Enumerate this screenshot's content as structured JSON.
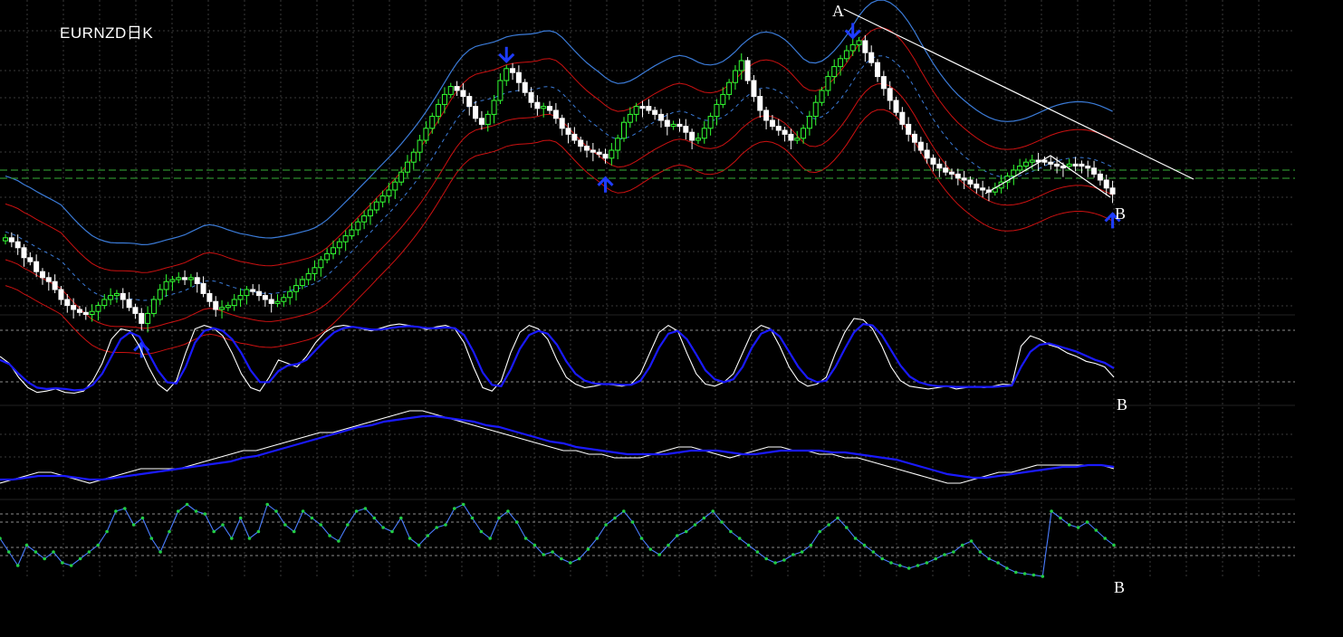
{
  "chart_data": [
    {
      "type": "candlestick",
      "title": "EURNZD日K",
      "grid": true,
      "overlays": [
        "Bollinger upper (blue)",
        "Keltner bands (red)",
        "middle dashed (blue)"
      ],
      "annotations": [
        {
          "label": "A",
          "bar": 137
        },
        {
          "label": "B",
          "bar": 179
        }
      ],
      "horizontal_levels_color": "#2e8b2e",
      "up_color": "#33ff33",
      "down_color": "#ffffff",
      "arrow_color": "#1e3cff",
      "arrows": [
        {
          "bar": 22,
          "dir": "up"
        },
        {
          "bar": 81,
          "dir": "down"
        },
        {
          "bar": 97,
          "dir": "up"
        },
        {
          "bar": 137,
          "dir": "down"
        },
        {
          "bar": 179,
          "dir": "up"
        }
      ],
      "close": [
        228,
        232,
        238,
        248,
        252,
        262,
        268,
        272,
        280,
        290,
        296,
        300,
        303,
        305,
        302,
        296,
        290,
        286,
        284,
        290,
        298,
        304,
        314,
        304,
        290,
        280,
        272,
        270,
        268,
        270,
        268,
        274,
        284,
        292,
        300,
        298,
        296,
        290,
        286,
        280,
        282,
        286,
        290,
        294,
        292,
        288,
        282,
        276,
        270,
        264,
        258,
        250,
        244,
        238,
        232,
        226,
        220,
        212,
        206,
        200,
        192,
        186,
        180,
        172,
        162,
        152,
        142,
        130,
        118,
        106,
        94,
        84,
        76,
        80,
        86,
        96,
        108,
        114,
        104,
        90,
        70,
        58,
        62,
        72,
        82,
        92,
        98,
        96,
        100,
        108,
        118,
        124,
        130,
        136,
        140,
        142,
        144,
        148,
        140,
        128,
        112,
        104,
        96,
        96,
        100,
        104,
        110,
        116,
        114,
        116,
        122,
        130,
        128,
        118,
        106,
        94,
        84,
        72,
        60,
        50,
        70,
        86,
        100,
        110,
        116,
        120,
        124,
        130,
        128,
        118,
        106,
        92,
        80,
        66,
        56,
        48,
        40,
        34,
        30,
        42,
        52,
        66,
        78,
        90,
        102,
        114,
        124,
        132,
        140,
        148,
        154,
        158,
        162,
        164,
        168,
        170,
        174,
        178,
        180,
        182,
        178,
        172,
        166,
        160,
        156,
        152,
        150,
        150,
        152,
        154,
        156,
        156,
        154,
        154,
        156,
        158,
        164,
        170,
        178,
        184
      ]
    },
    {
      "type": "line",
      "name": "oscillator-1",
      "series": [
        {
          "color": "#ffffff",
          "values": [
            55,
            45,
            25,
            10,
            3,
            5,
            8,
            3,
            2,
            5,
            20,
            45,
            80,
            95,
            92,
            70,
            40,
            15,
            5,
            20,
            60,
            95,
            100,
            96,
            85,
            60,
            30,
            10,
            5,
            25,
            50,
            45,
            40,
            55,
            75,
            90,
            98,
            100,
            98,
            95,
            92,
            96,
            100,
            102,
            100,
            98,
            94,
            98,
            100,
            95,
            75,
            40,
            10,
            5,
            20,
            60,
            90,
            100,
            95,
            80,
            50,
            25,
            15,
            10,
            12,
            15,
            14,
            12,
            15,
            30,
            60,
            90,
            100,
            92,
            60,
            30,
            15,
            12,
            18,
            30,
            60,
            90,
            100,
            95,
            70,
            40,
            20,
            12,
            15,
            25,
            60,
            90,
            110,
            108,
            95,
            70,
            40,
            20,
            12,
            10,
            8,
            10,
            12,
            8,
            10,
            12,
            10,
            12,
            15,
            14,
            70,
            85,
            80,
            72,
            68,
            60,
            55,
            48,
            45,
            40,
            25
          ]
        },
        {
          "color": "#1a1aff",
          "values": [
            50,
            44,
            30,
            18,
            10,
            8,
            9,
            8,
            6,
            7,
            14,
            30,
            55,
            80,
            90,
            84,
            60,
            35,
            18,
            16,
            40,
            75,
            92,
            96,
            92,
            80,
            60,
            35,
            18,
            18,
            34,
            42,
            44,
            50,
            64,
            78,
            90,
            96,
            98,
            96,
            94,
            94,
            96,
            98,
            99,
            98,
            96,
            96,
            97,
            96,
            86,
            62,
            32,
            14,
            12,
            36,
            66,
            86,
            92,
            88,
            72,
            48,
            30,
            20,
            16,
            15,
            15,
            14,
            14,
            20,
            40,
            68,
            88,
            92,
            80,
            58,
            35,
            22,
            18,
            22,
            40,
            68,
            88,
            94,
            84,
            62,
            40,
            24,
            18,
            20,
            40,
            66,
            90,
            102,
            100,
            86,
            64,
            42,
            26,
            18,
            14,
            12,
            12,
            11,
            11,
            11,
            11,
            11,
            12,
            13,
            40,
            62,
            72,
            74,
            70,
            66,
            62,
            56,
            50,
            46,
            38
          ]
        }
      ]
    },
    {
      "type": "line",
      "name": "oscillator-2",
      "series": [
        {
          "color": "#ffffff",
          "values": [
            52,
            54,
            56,
            58,
            58,
            56,
            54,
            52,
            54,
            56,
            58,
            60,
            60,
            60,
            60,
            62,
            64,
            66,
            68,
            70,
            70,
            72,
            74,
            76,
            78,
            80,
            80,
            82,
            84,
            86,
            88,
            90,
            92,
            92,
            90,
            88,
            86,
            84,
            82,
            80,
            78,
            76,
            74,
            72,
            70,
            70,
            68,
            68,
            66,
            66,
            66,
            68,
            70,
            72,
            72,
            70,
            68,
            66,
            68,
            70,
            72,
            72,
            70,
            70,
            68,
            68,
            66,
            66,
            64,
            62,
            60,
            58,
            56,
            54,
            52,
            52,
            54,
            56,
            58,
            58,
            60,
            62,
            62,
            62,
            62,
            62,
            62,
            60
          ]
        },
        {
          "color": "#1a1aff",
          "values": [
            54,
            54,
            55,
            56,
            56,
            56,
            55,
            54,
            54,
            55,
            56,
            57,
            58,
            59,
            60,
            61,
            62,
            63,
            64,
            66,
            67,
            69,
            71,
            73,
            75,
            77,
            79,
            81,
            83,
            84,
            86,
            87,
            88,
            89,
            89,
            88,
            87,
            86,
            84,
            83,
            81,
            79,
            77,
            75,
            74,
            72,
            71,
            70,
            69,
            68,
            68,
            68,
            68,
            69,
            70,
            70,
            70,
            69,
            68,
            68,
            69,
            70,
            70,
            70,
            70,
            69,
            69,
            68,
            67,
            66,
            65,
            63,
            61,
            59,
            57,
            56,
            55,
            55,
            56,
            57,
            58,
            59,
            60,
            61,
            61,
            62,
            62,
            61
          ]
        }
      ]
    },
    {
      "type": "line",
      "name": "oscillator-3",
      "series": [
        {
          "color": "#4a7dff",
          "marker_color": "#22cc44",
          "values": [
            40,
            30,
            20,
            35,
            30,
            25,
            30,
            22,
            20,
            25,
            30,
            35,
            45,
            60,
            62,
            50,
            55,
            40,
            30,
            45,
            60,
            65,
            60,
            58,
            45,
            50,
            40,
            55,
            40,
            45,
            65,
            60,
            50,
            45,
            60,
            55,
            50,
            42,
            38,
            50,
            60,
            62,
            55,
            48,
            45,
            55,
            40,
            35,
            42,
            48,
            50,
            62,
            65,
            55,
            45,
            40,
            55,
            60,
            52,
            40,
            35,
            28,
            30,
            25,
            22,
            25,
            32,
            40,
            50,
            55,
            60,
            52,
            40,
            32,
            28,
            35,
            42,
            45,
            50,
            55,
            60,
            52,
            45,
            40,
            35,
            30,
            25,
            22,
            24,
            28,
            30,
            35,
            45,
            50,
            55,
            48,
            40,
            35,
            30,
            25,
            22,
            20,
            18,
            20,
            22,
            25,
            28,
            30,
            35,
            38,
            30,
            25,
            22,
            18,
            15,
            14,
            13,
            12,
            60,
            55,
            50,
            48,
            52,
            46,
            40,
            35
          ]
        }
      ]
    }
  ]
}
